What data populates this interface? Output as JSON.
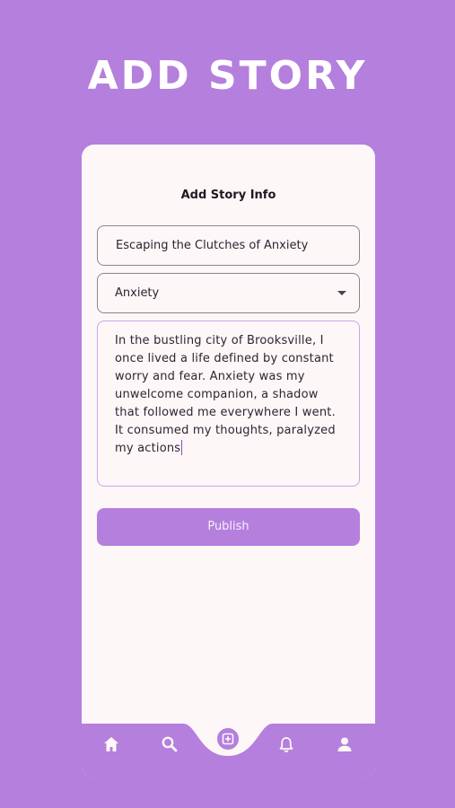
{
  "header": {
    "title": "ADD STORY"
  },
  "form": {
    "title": "Add Story Info",
    "story_title_value": "Escaping the Clutches of Anxiety",
    "category_value": "Anxiety",
    "story_text": "In the bustling city of Brooksville, I once lived a life defined by constant worry and fear. Anxiety was my unwelcome companion, a shadow that followed me everywhere I went. It consumed my thoughts, paralyzed my actions",
    "publish_label": "Publish"
  },
  "nav": {
    "items": [
      {
        "icon": "home-icon"
      },
      {
        "icon": "search-icon"
      },
      {
        "icon": "add-icon"
      },
      {
        "icon": "bell-icon"
      },
      {
        "icon": "profile-icon"
      }
    ]
  },
  "colors": {
    "background": "#B57FDD",
    "card": "#FDF7F8",
    "accent": "#B57FDD"
  }
}
